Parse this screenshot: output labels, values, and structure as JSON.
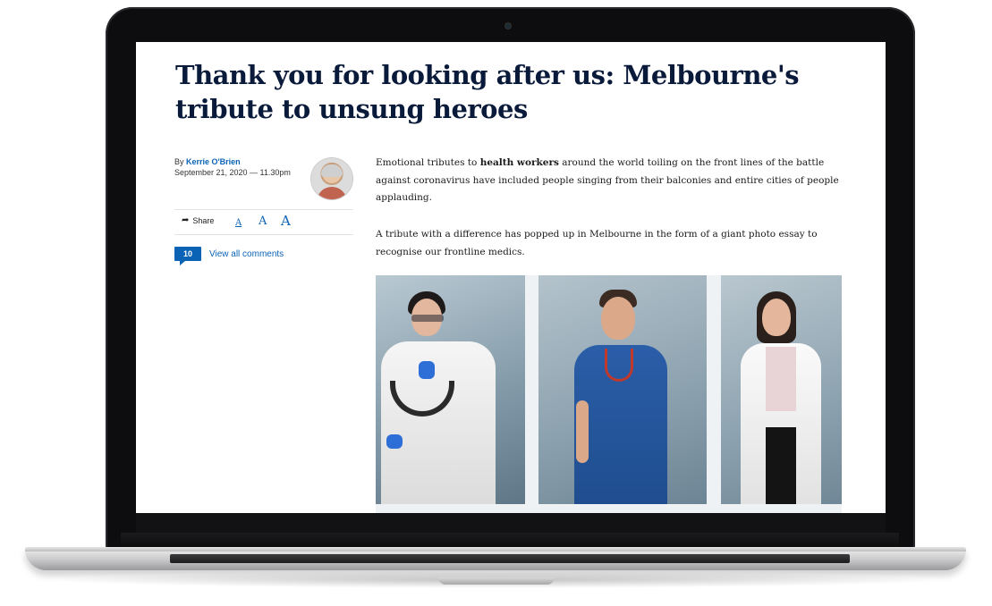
{
  "article": {
    "headline": "Thank you for looking after us: Melbourne's tribute to unsung heroes",
    "byline": {
      "prefix": "By ",
      "author": "Kerrie O'Brien",
      "date": "September 21, 2020 — 11.30pm"
    },
    "tools": {
      "share_label": "Share",
      "font_small": "A",
      "font_medium": "A",
      "font_large": "A"
    },
    "comments": {
      "count": "10",
      "link_label": "View all comments"
    },
    "paragraph1": {
      "pre": "Emotional tributes to ",
      "bold": "health workers",
      "post": " around the world toiling on the front lines of the battle against coronavirus have included people singing from their balconies and entire cities of people applauding."
    },
    "paragraph2": "A tribute with a difference has popped up in Melbourne in the form of a giant photo essay to recognise our frontline medics."
  },
  "colors": {
    "headline": "#0a1a3a",
    "link": "#0b63b5"
  },
  "icons": {
    "share": "share-arrow-icon",
    "comments": "speech-bubble-icon"
  }
}
